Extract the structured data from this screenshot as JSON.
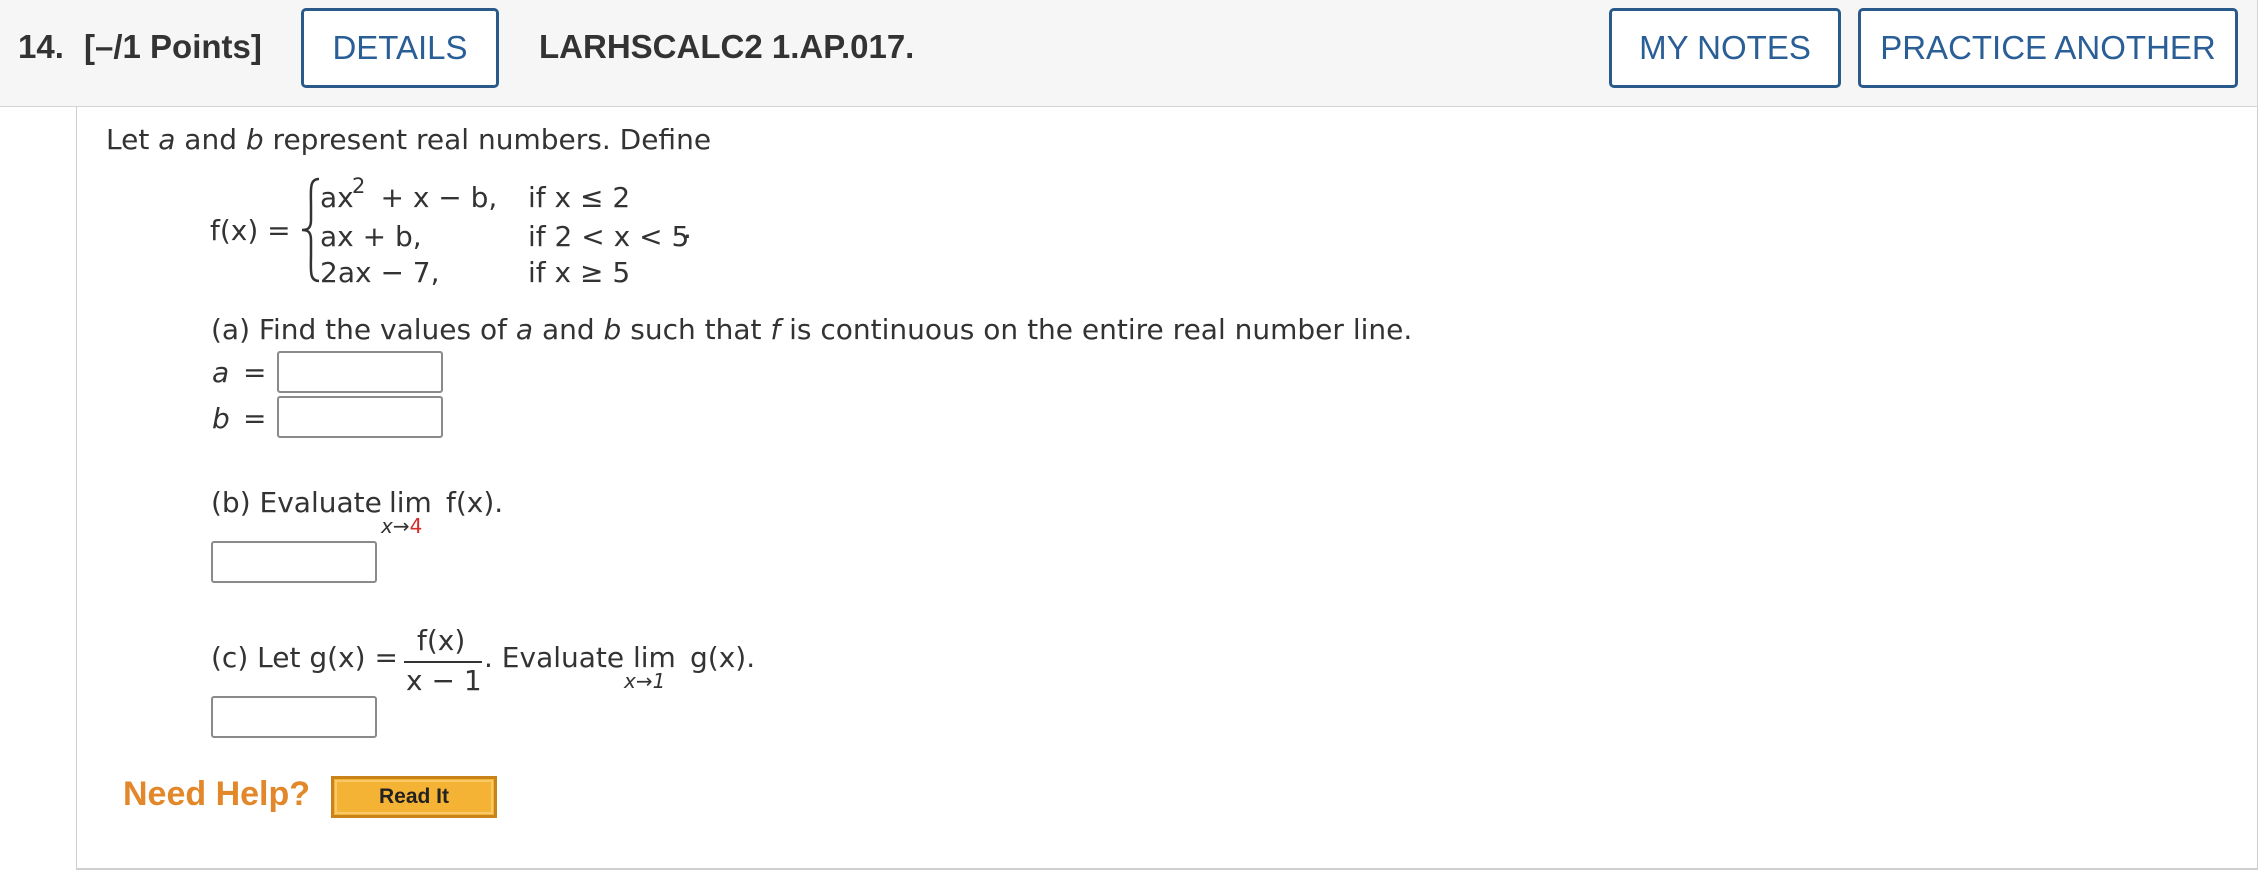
{
  "header": {
    "question_number": "14.",
    "points": "[–/1 Points]",
    "details_label": "DETAILS",
    "question_code": "LARHSCALC2 1.AP.017.",
    "my_notes_label": "MY NOTES",
    "practice_another_label": "PRACTICE ANOTHER"
  },
  "problem": {
    "intro": {
      "t1": "Let ",
      "a": "a",
      "t2": " and ",
      "b": "b",
      "t3": " represent real numbers. Define"
    },
    "function": {
      "lhs": "f(x) =",
      "piece1_expr": "ax",
      "piece1_exp": "2",
      "piece1_rest": "+ x − b,",
      "piece1_cond": "if x ≤ 2",
      "piece2_expr": "ax + b,",
      "piece2_cond": "if 2 < x < 5",
      "piece2_dot": "·",
      "piece3_expr": "2ax − 7,",
      "piece3_cond": "if x ≥ 5"
    },
    "part_a": {
      "text1": "(a) Find the values of ",
      "a": "a",
      "text2": " and ",
      "b": "b",
      "text3": " such that ",
      "f": "f",
      "text4": " is continuous on the entire real number line.",
      "a_label": "a",
      "b_label": "b",
      "equals": "="
    },
    "part_b": {
      "text": "(b) Evaluate",
      "lim": "lim",
      "sub_x": "x→",
      "sub_val": "4",
      "fx": "f(x)."
    },
    "part_c": {
      "text1": "(c) Let g(x) =",
      "numerator": "f(x)",
      "denominator": "x − 1",
      "text2": ". Evaluate",
      "lim": "lim",
      "sub": "x→1",
      "gx": "g(x)."
    }
  },
  "help": {
    "need_help": "Need Help?",
    "read_it": "Read It"
  }
}
